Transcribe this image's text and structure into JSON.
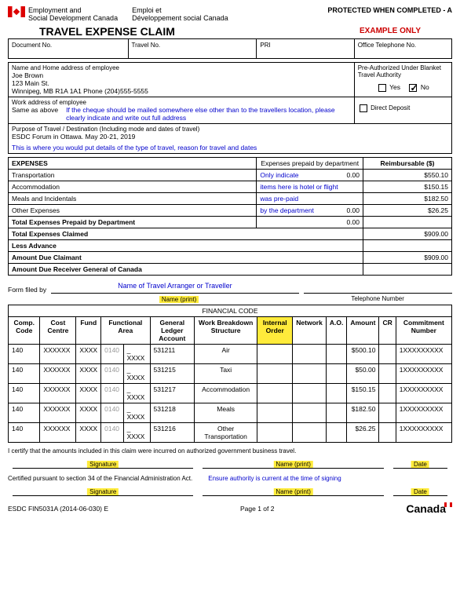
{
  "header": {
    "dept_en1": "Employment and",
    "dept_en2": "Social Development Canada",
    "dept_fr1": "Emploi et",
    "dept_fr2": "Développement social Canada",
    "protected": "PROTECTED WHEN COMPLETED - A",
    "title": "TRAVEL EXPENSE CLAIM",
    "example": "EXAMPLE ONLY"
  },
  "top": {
    "doc_no": "Document No.",
    "travel_no": "Travel No.",
    "pri": "PRI",
    "office_tel": "Office Telephone No."
  },
  "emp": {
    "label": "Name and Home address of employee",
    "name": "Joe Brown",
    "addr1": "123 Main St.",
    "addr2": "Winnipeg, MB   R1A 1A1       Phone (204)555-5555",
    "preauth": "Pre-Authorized Under Blanket Travel Authority",
    "yes": "Yes",
    "no": "No"
  },
  "work": {
    "label": "Work address of employee",
    "same": "Same as above",
    "note": "If the cheque should be mailed somewhere else other than to the travellers location, please clearly indicate and write out full address",
    "dd": "Direct Deposit"
  },
  "purpose": {
    "label": "Purpose of Travel / Destination (Including mode and dates of travel)",
    "text": "ESDC Forum in Ottawa. May 20-21, 2019",
    "note": "This is where you would put details of the type of travel, reason for travel and dates"
  },
  "exp": {
    "header1": "EXPENSES",
    "header2": "Expenses prepaid by department",
    "header3": "Reimbursable ($)",
    "rows": [
      {
        "label": "Transportation",
        "prepaid": "0.00",
        "reimb": "$550.10"
      },
      {
        "label": "Accommodation",
        "prepaid": "",
        "reimb": "$150.15"
      },
      {
        "label": "Meals and Incidentals",
        "prepaid": "",
        "reimb": "$182.50"
      },
      {
        "label": "Other Expenses",
        "prepaid": "0.00",
        "reimb": "$26.25"
      }
    ],
    "note1": "Only indicate",
    "note2": "items here is hotel or flight",
    "note3": "was pre-paid",
    "note4": "by the department",
    "total_prepaid_label": "Total Expenses Prepaid by Department",
    "total_prepaid": "0.00",
    "total_claimed_label": "Total Expenses Claimed",
    "total_claimed": "$909.00",
    "less_advance": "Less Advance",
    "amt_due_claimant_label": "Amount Due Claimant",
    "amt_due_claimant": "$909.00",
    "amt_due_rgc": "Amount Due Receiver General of Canada"
  },
  "filed": {
    "label": "Form filed by",
    "note": "Name of Travel Arranger or Traveller",
    "name_print": "Name (print)",
    "tel": "Telephone Number"
  },
  "fin": {
    "header": "FINANCIAL CODE",
    "cols": {
      "comp": "Comp. Code",
      "cost": "Cost Centre",
      "fund": "Fund",
      "fa": "Functional Area",
      "gl": "General Ledger Account",
      "wbs": "Work Breakdown Structure",
      "io": "Internal Order",
      "net": "Network",
      "ao": "A.O.",
      "amt": "Amount",
      "cr": "CR",
      "cn": "Commitment Number"
    },
    "rows": [
      {
        "comp": "140",
        "cost": "XXXXXX",
        "fund": "XXXX",
        "fa1": "0140",
        "fa2": "_ XXXX",
        "gl": "531211",
        "wbs": "Air",
        "amt": "$500.10",
        "cn": "1XXXXXXXXX"
      },
      {
        "comp": "140",
        "cost": "XXXXXX",
        "fund": "XXXX",
        "fa1": "0140",
        "fa2": "_ XXXX",
        "gl": "531215",
        "wbs": "Taxi",
        "amt": "$50.00",
        "cn": "1XXXXXXXXX"
      },
      {
        "comp": "140",
        "cost": "XXXXXX",
        "fund": "XXXX",
        "fa1": "0140",
        "fa2": "_ XXXX",
        "gl": "531217",
        "wbs": "Accommodation",
        "amt": "$150.15",
        "cn": "1XXXXXXXXX"
      },
      {
        "comp": "140",
        "cost": "XXXXXX",
        "fund": "XXXX",
        "fa1": "0140",
        "fa2": "_ XXXX",
        "gl": "531218",
        "wbs": "Meals",
        "amt": "$182.50",
        "cn": "1XXXXXXXXX"
      },
      {
        "comp": "140",
        "cost": "XXXXXX",
        "fund": "XXXX",
        "fa1": "0140",
        "fa2": "_ XXXX",
        "gl": "531216",
        "wbs": "Other Transportation",
        "amt": "$26.25",
        "cn": "1XXXXXXXXX"
      }
    ]
  },
  "cert": {
    "text": "I certify that the amounts included in this claim were incurred on authorized government business travel.",
    "sig": "Signature",
    "name": "Name (print)",
    "date": "Date",
    "sec34": "Certified pursuant to section 34 of the Financial Administration Act.",
    "auth_note": "Ensure authority is current at the time of signing"
  },
  "footer": {
    "form": "ESDC FIN5031A (2014-06-030) E",
    "page": "Page 1 of 2",
    "canada": "Canada"
  }
}
